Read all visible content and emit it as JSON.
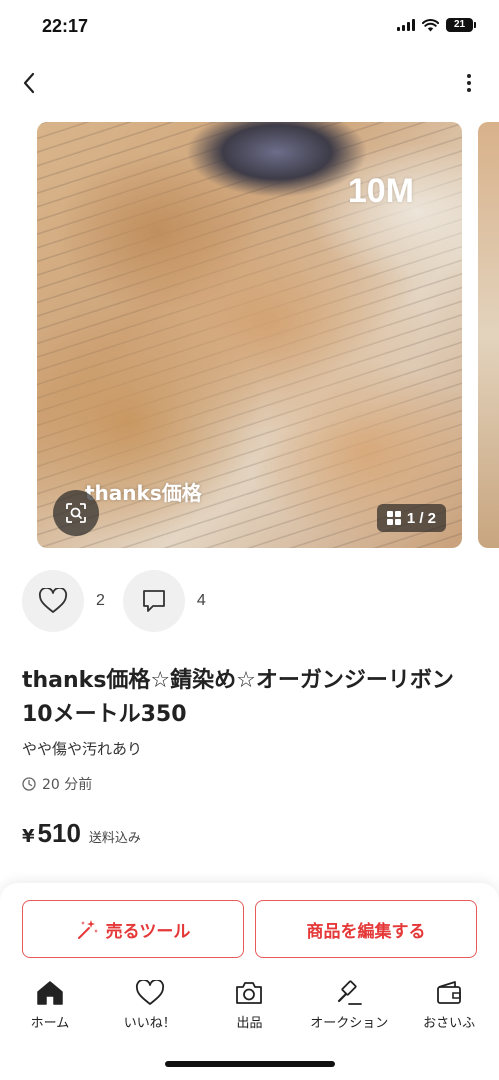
{
  "status_bar": {
    "time": "22:17",
    "battery": "21"
  },
  "gallery": {
    "overlay_title": "10M",
    "overlay_caption": "thanks価格",
    "counter": "1 / 2"
  },
  "reactions": {
    "likes": "2",
    "comments": "4"
  },
  "item": {
    "title": "thanks価格☆錆染め☆オーガンジーリボン10メートル350",
    "condition": "やや傷や汚れあり",
    "posted": "20 分前",
    "price_currency": "¥",
    "price": "510",
    "price_note": "送料込み"
  },
  "actions": {
    "sell_tool": "売るツール",
    "edit_item": "商品を編集する"
  },
  "tab_bar": {
    "items": [
      {
        "label": "ホーム",
        "icon": "home-icon"
      },
      {
        "label": "いいね！",
        "icon": "heart-icon"
      },
      {
        "label": "出品",
        "icon": "camera-icon"
      },
      {
        "label": "オークション",
        "icon": "gavel-icon"
      },
      {
        "label": "おさいふ",
        "icon": "wallet-icon"
      }
    ]
  },
  "colors": {
    "accent": "#e53838",
    "reaction_bg": "#f0f0f0"
  }
}
